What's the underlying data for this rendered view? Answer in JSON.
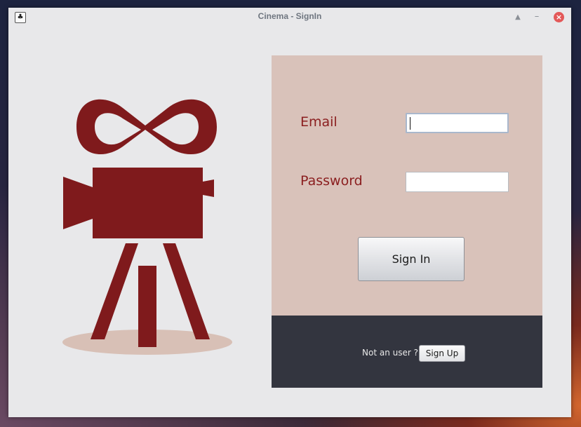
{
  "window": {
    "title": "Cinema - SignIn",
    "icon": "app-icon",
    "controls": [
      "maximize-icon",
      "minimize-icon",
      "close-icon"
    ]
  },
  "logo": {
    "icon": "movie-camera-on-tripod-logo",
    "color": "#7f1a1c",
    "shadow_color": "#d8c0b6"
  },
  "form": {
    "email_label": "Email",
    "email_value": "",
    "password_label": "Password",
    "password_value": "",
    "signin_label": "Sign In",
    "label_color": "#8b1f20",
    "panel_color": "#d9c2ba"
  },
  "footer": {
    "prompt": "Not an user ?",
    "signup_label": "Sign Up",
    "background": "#33353f"
  }
}
